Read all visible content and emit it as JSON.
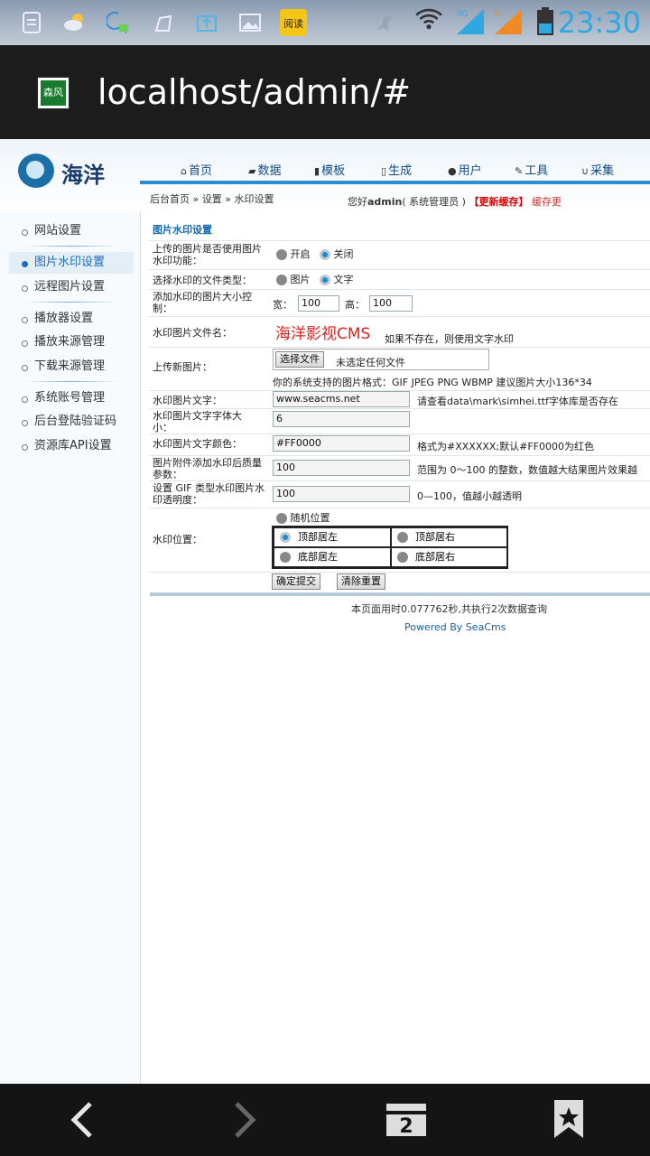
{
  "status_bar": {
    "time": "23:30",
    "icons": [
      "clipboard-icon",
      "weather-icon",
      "chat-icon",
      "cleaner-icon",
      "upload-icon",
      "gallery-icon",
      "app-icon",
      "wifi-icon",
      "signal-3g-icon",
      "signal-g-icon",
      "battery-icon"
    ]
  },
  "browser": {
    "url": "localhost/admin/#",
    "favicon_text": "森风"
  },
  "brand": {
    "name": "海洋"
  },
  "nav": {
    "items": [
      {
        "icon": "home-icon",
        "label": "首页"
      },
      {
        "icon": "data-icon",
        "label": "数据"
      },
      {
        "icon": "template-icon",
        "label": "模板"
      },
      {
        "icon": "generate-icon",
        "label": "生成"
      },
      {
        "icon": "user-icon",
        "label": "用户"
      },
      {
        "icon": "tools-icon",
        "label": "工具"
      },
      {
        "icon": "collect-icon",
        "label": "采集"
      }
    ]
  },
  "breadcrumb": "后台首页 » 设置 » 水印设置",
  "welcome": {
    "prefix": "您好",
    "user": "admin",
    "role": "( 系统管理员 )",
    "update_cache": "【更新缓存】",
    "cache_status": "缓存更"
  },
  "sidebar": {
    "items": [
      {
        "label": "网站设置"
      },
      {
        "label": "图片水印设置"
      },
      {
        "label": "远程图片设置"
      },
      {
        "label": "播放器设置"
      },
      {
        "label": "播放来源管理"
      },
      {
        "label": "下载来源管理"
      },
      {
        "label": "系统账号管理"
      },
      {
        "label": "后台登陆验证码"
      },
      {
        "label": "资源库API设置"
      }
    ]
  },
  "form": {
    "title": "图片水印设置",
    "enable_label": "上传的图片是否使用图片水印功能：",
    "enable_on": "开启",
    "enable_off": "关闭",
    "type_label": "选择水印的文件类型：",
    "type_image": "图片",
    "type_text": "文字",
    "size_label": "添加水印的图片大小控制：",
    "width_label": "宽：",
    "width_value": "100",
    "height_label": "高：",
    "height_value": "100",
    "file_label": "水印图片文件名：",
    "file_preview": "海洋影视CMS",
    "file_note": "如果不存在，则使用文字水印",
    "upload_label": "上传新图片：",
    "choose_file": "选择文件",
    "no_file": "未选定任何文件",
    "formats_note": "你的系统支持的图片格式：GIF JPEG PNG WBMP 建议图片大小136*34",
    "text_label": "水印图片文字：",
    "text_value": "www.seacms.net",
    "text_note": "请查看data\\mark\\simhei.ttf字体库是否存在",
    "fontsize_label": "水印图片文字字体大小：",
    "fontsize_value": "6",
    "color_label": "水印图片文字颜色：",
    "color_value": "#FF0000",
    "color_note": "格式为#XXXXXX;默认#FF0000为红色",
    "quality_label": "图片附件添加水印后质量参数：",
    "quality_value": "100",
    "quality_note": "范围为 0～100 的整数，数值越大结果图片效果越",
    "alpha_label": "设置 GIF 类型水印图片水印透明度：",
    "alpha_value": "100",
    "alpha_note": "0—100，值越小越透明",
    "pos_label": "水印位置：",
    "pos_random": "随机位置",
    "pos_top_left": "顶部居左",
    "pos_top_right": "顶部居右",
    "pos_bottom_left": "底部居左",
    "pos_bottom_right": "底部居右",
    "submit": "确定提交",
    "reset": "清除重置"
  },
  "footer": {
    "stats": "本页面用时0.077762秒,共执行2次数据查询",
    "powered": "Powered By SeaCms"
  },
  "bottom_nav": {
    "tabs_count": "2"
  }
}
